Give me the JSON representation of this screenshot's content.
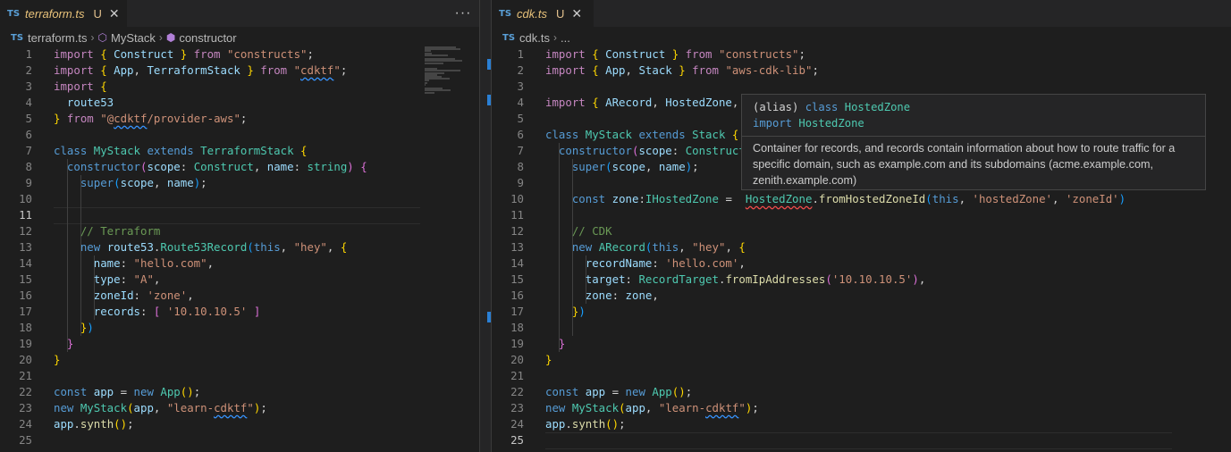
{
  "left": {
    "tab": {
      "label": "terraform.ts",
      "modified": "U",
      "icon": "TS"
    },
    "more_label": "···",
    "breadcrumb": [
      "terraform.ts",
      "MyStack",
      "constructor"
    ],
    "lines": [
      {
        "n": "1",
        "t": [
          [
            "kc",
            "import "
          ],
          [
            "b1",
            "{ "
          ],
          [
            "vr",
            "Construct"
          ],
          [
            "b1",
            " }"
          ],
          [
            "kc",
            " from "
          ],
          [
            "st",
            "\"constructs\""
          ],
          [
            "pl",
            ";"
          ]
        ]
      },
      {
        "n": "2",
        "t": [
          [
            "kc",
            "import "
          ],
          [
            "b1",
            "{ "
          ],
          [
            "vr",
            "App"
          ],
          [
            "pl",
            ", "
          ],
          [
            "vr",
            "TerraformStack"
          ],
          [
            "b1",
            " }"
          ],
          [
            "kc",
            " from "
          ],
          [
            "st",
            "\""
          ],
          [
            "st sq",
            "cdktf"
          ],
          [
            "st",
            "\""
          ],
          [
            "pl",
            ";"
          ]
        ]
      },
      {
        "n": "3",
        "t": [
          [
            "kc",
            "import "
          ],
          [
            "b1",
            "{"
          ]
        ]
      },
      {
        "n": "4",
        "t": [
          [
            "pl",
            "  "
          ],
          [
            "vr",
            "route53"
          ]
        ]
      },
      {
        "n": "5",
        "t": [
          [
            "b1",
            "}"
          ],
          [
            "kc",
            " from "
          ],
          [
            "st",
            "\"@"
          ],
          [
            "st sq",
            "cdktf"
          ],
          [
            "st",
            "/provider-aws\""
          ],
          [
            "pl",
            ";"
          ]
        ]
      },
      {
        "n": "6",
        "t": []
      },
      {
        "n": "7",
        "t": [
          [
            "kw",
            "class "
          ],
          [
            "ty",
            "MyStack"
          ],
          [
            "kw",
            " extends "
          ],
          [
            "ty",
            "TerraformStack"
          ],
          [
            "b1",
            " {"
          ]
        ]
      },
      {
        "n": "8",
        "t": [
          [
            "pl",
            "  "
          ],
          [
            "kw",
            "constructor"
          ],
          [
            "b2",
            "("
          ],
          [
            "vr",
            "scope"
          ],
          [
            "pl",
            ": "
          ],
          [
            "ty",
            "Construct"
          ],
          [
            "pl",
            ", "
          ],
          [
            "vr",
            "name"
          ],
          [
            "pl",
            ": "
          ],
          [
            "ty",
            "string"
          ],
          [
            "b2",
            ")"
          ],
          [
            "b2",
            " {"
          ]
        ]
      },
      {
        "n": "9",
        "t": [
          [
            "pl",
            "    "
          ],
          [
            "kw",
            "super"
          ],
          [
            "b3",
            "("
          ],
          [
            "vr",
            "scope"
          ],
          [
            "pl",
            ", "
          ],
          [
            "vr",
            "name"
          ],
          [
            "b3",
            ")"
          ],
          [
            "pl",
            ";"
          ]
        ]
      },
      {
        "n": "10",
        "t": []
      },
      {
        "n": "11",
        "t": []
      },
      {
        "n": "12",
        "t": [
          [
            "pl",
            "    "
          ],
          [
            "cm",
            "// Terraform"
          ]
        ]
      },
      {
        "n": "13",
        "t": [
          [
            "pl",
            "    "
          ],
          [
            "kw",
            "new "
          ],
          [
            "vr",
            "route53"
          ],
          [
            "pl",
            "."
          ],
          [
            "ty",
            "Route53Record"
          ],
          [
            "b3",
            "("
          ],
          [
            "kw",
            "this"
          ],
          [
            "pl",
            ", "
          ],
          [
            "st",
            "\"hey\""
          ],
          [
            "pl",
            ", "
          ],
          [
            "b1",
            "{"
          ]
        ]
      },
      {
        "n": "14",
        "t": [
          [
            "pl",
            "      "
          ],
          [
            "vr",
            "name"
          ],
          [
            "pl",
            ": "
          ],
          [
            "st",
            "\"hello.com\""
          ],
          [
            "pl",
            ","
          ]
        ]
      },
      {
        "n": "15",
        "t": [
          [
            "pl",
            "      "
          ],
          [
            "vr",
            "type"
          ],
          [
            "pl",
            ": "
          ],
          [
            "st",
            "\"A\""
          ],
          [
            "pl",
            ","
          ]
        ]
      },
      {
        "n": "16",
        "t": [
          [
            "pl",
            "      "
          ],
          [
            "vr",
            "zoneId"
          ],
          [
            "pl",
            ": "
          ],
          [
            "st",
            "'zone'"
          ],
          [
            "pl",
            ","
          ]
        ]
      },
      {
        "n": "17",
        "t": [
          [
            "pl",
            "      "
          ],
          [
            "vr",
            "records"
          ],
          [
            "pl",
            ": "
          ],
          [
            "b2",
            "[ "
          ],
          [
            "st",
            "'10.10.10.5'"
          ],
          [
            "b2",
            " ]"
          ]
        ]
      },
      {
        "n": "18",
        "t": [
          [
            "pl",
            "    "
          ],
          [
            "b1",
            "}"
          ],
          [
            "b3",
            ")"
          ]
        ]
      },
      {
        "n": "19",
        "t": [
          [
            "pl",
            "  "
          ],
          [
            "b2",
            "}"
          ]
        ]
      },
      {
        "n": "20",
        "t": [
          [
            "b1",
            "}"
          ]
        ]
      },
      {
        "n": "21",
        "t": []
      },
      {
        "n": "22",
        "t": [
          [
            "kw",
            "const "
          ],
          [
            "vr",
            "app"
          ],
          [
            "pl",
            " = "
          ],
          [
            "kw",
            "new "
          ],
          [
            "ty",
            "App"
          ],
          [
            "b1",
            "()"
          ],
          [
            "pl",
            ";"
          ]
        ]
      },
      {
        "n": "23",
        "t": [
          [
            "kw",
            "new "
          ],
          [
            "ty",
            "MyStack"
          ],
          [
            "b1",
            "("
          ],
          [
            "vr",
            "app"
          ],
          [
            "pl",
            ", "
          ],
          [
            "st",
            "\"learn-"
          ],
          [
            "st sq",
            "cdktf"
          ],
          [
            "st",
            "\""
          ],
          [
            "b1",
            ")"
          ],
          [
            "pl",
            ";"
          ]
        ]
      },
      {
        "n": "24",
        "t": [
          [
            "vr",
            "app"
          ],
          [
            "pl",
            "."
          ],
          [
            "fn",
            "synth"
          ],
          [
            "b1",
            "()"
          ],
          [
            "pl",
            ";"
          ]
        ]
      },
      {
        "n": "25",
        "t": []
      }
    ]
  },
  "right": {
    "tab": {
      "label": "cdk.ts",
      "modified": "U",
      "icon": "TS"
    },
    "breadcrumb": [
      "cdk.ts",
      "..."
    ],
    "lines": [
      {
        "n": "1",
        "t": [
          [
            "kc",
            "import "
          ],
          [
            "b1",
            "{ "
          ],
          [
            "vr",
            "Construct"
          ],
          [
            "b1",
            " }"
          ],
          [
            "kc",
            " from "
          ],
          [
            "st",
            "\"constructs\""
          ],
          [
            "pl",
            ";"
          ]
        ]
      },
      {
        "n": "2",
        "t": [
          [
            "kc",
            "import "
          ],
          [
            "b1",
            "{ "
          ],
          [
            "vr",
            "App"
          ],
          [
            "pl",
            ", "
          ],
          [
            "vr",
            "Stack"
          ],
          [
            "b1",
            " }"
          ],
          [
            "kc",
            " from "
          ],
          [
            "st",
            "\"aws-cdk-lib\""
          ],
          [
            "pl",
            ";"
          ]
        ]
      },
      {
        "n": "3",
        "t": []
      },
      {
        "n": "4",
        "t": [
          [
            "kc",
            "import "
          ],
          [
            "b1",
            "{ "
          ],
          [
            "vr",
            "ARecord"
          ],
          [
            "pl",
            ", "
          ],
          [
            "vr",
            "HostedZone"
          ],
          [
            "pl",
            ","
          ]
        ]
      },
      {
        "n": "5",
        "t": []
      },
      {
        "n": "6",
        "t": [
          [
            "kw",
            "class "
          ],
          [
            "ty",
            "MyStack"
          ],
          [
            "kw",
            " extends "
          ],
          [
            "ty",
            "Stack"
          ],
          [
            "b1",
            " {"
          ]
        ]
      },
      {
        "n": "7",
        "t": [
          [
            "pl",
            "  "
          ],
          [
            "kw",
            "constructor"
          ],
          [
            "b2",
            "("
          ],
          [
            "vr",
            "scope"
          ],
          [
            "pl",
            ": "
          ],
          [
            "ty",
            "Construct"
          ]
        ]
      },
      {
        "n": "8",
        "t": [
          [
            "pl",
            "    "
          ],
          [
            "kw",
            "super"
          ],
          [
            "b3",
            "("
          ],
          [
            "vr",
            "scope"
          ],
          [
            "pl",
            ", "
          ],
          [
            "vr",
            "name"
          ],
          [
            "b3",
            ")"
          ],
          [
            "pl",
            ";"
          ]
        ]
      },
      {
        "n": "9",
        "t": []
      },
      {
        "n": "10",
        "t": [
          [
            "pl",
            "    "
          ],
          [
            "kw",
            "const "
          ],
          [
            "vr",
            "zone"
          ],
          [
            "pl",
            ":"
          ],
          [
            "ty",
            "IHostedZone"
          ],
          [
            "pl",
            " =  "
          ],
          [
            "ty err",
            "HostedZone"
          ],
          [
            "pl",
            "."
          ],
          [
            "fn",
            "fromHostedZoneId"
          ],
          [
            "b3",
            "("
          ],
          [
            "kw",
            "this"
          ],
          [
            "pl",
            ", "
          ],
          [
            "st",
            "'hostedZone'"
          ],
          [
            "pl",
            ", "
          ],
          [
            "st",
            "'zoneId'"
          ],
          [
            "b3",
            ")"
          ]
        ]
      },
      {
        "n": "11",
        "t": []
      },
      {
        "n": "12",
        "t": [
          [
            "pl",
            "    "
          ],
          [
            "cm",
            "// CDK"
          ]
        ]
      },
      {
        "n": "13",
        "t": [
          [
            "pl",
            "    "
          ],
          [
            "kw",
            "new "
          ],
          [
            "ty",
            "ARecord"
          ],
          [
            "b3",
            "("
          ],
          [
            "kw",
            "this"
          ],
          [
            "pl",
            ", "
          ],
          [
            "st",
            "\"hey\""
          ],
          [
            "pl",
            ", "
          ],
          [
            "b1",
            "{"
          ]
        ]
      },
      {
        "n": "14",
        "t": [
          [
            "pl",
            "      "
          ],
          [
            "vr",
            "recordName"
          ],
          [
            "pl",
            ": "
          ],
          [
            "st",
            "'hello.com'"
          ],
          [
            "pl",
            ","
          ]
        ]
      },
      {
        "n": "15",
        "t": [
          [
            "pl",
            "      "
          ],
          [
            "vr",
            "target"
          ],
          [
            "pl",
            ": "
          ],
          [
            "ty",
            "RecordTarget"
          ],
          [
            "pl",
            "."
          ],
          [
            "fn",
            "fromIpAddresses"
          ],
          [
            "b2",
            "("
          ],
          [
            "st",
            "'10.10.10.5'"
          ],
          [
            "b2",
            ")"
          ],
          [
            "pl",
            ","
          ]
        ]
      },
      {
        "n": "16",
        "t": [
          [
            "pl",
            "      "
          ],
          [
            "vr",
            "zone"
          ],
          [
            "pl",
            ": "
          ],
          [
            "vr",
            "zone"
          ],
          [
            "pl",
            ","
          ]
        ]
      },
      {
        "n": "17",
        "t": [
          [
            "pl",
            "    "
          ],
          [
            "b1",
            "}"
          ],
          [
            "b3",
            ")"
          ]
        ]
      },
      {
        "n": "18",
        "t": []
      },
      {
        "n": "19",
        "t": [
          [
            "pl",
            "  "
          ],
          [
            "b2",
            "}"
          ]
        ]
      },
      {
        "n": "20",
        "t": [
          [
            "b1",
            "}"
          ]
        ]
      },
      {
        "n": "21",
        "t": []
      },
      {
        "n": "22",
        "t": [
          [
            "kw",
            "const "
          ],
          [
            "vr",
            "app"
          ],
          [
            "pl",
            " = "
          ],
          [
            "kw",
            "new "
          ],
          [
            "ty",
            "App"
          ],
          [
            "b1",
            "()"
          ],
          [
            "pl",
            ";"
          ]
        ]
      },
      {
        "n": "23",
        "t": [
          [
            "kw",
            "new "
          ],
          [
            "ty",
            "MyStack"
          ],
          [
            "b1",
            "("
          ],
          [
            "vr",
            "app"
          ],
          [
            "pl",
            ", "
          ],
          [
            "st",
            "\"learn-"
          ],
          [
            "st sq",
            "cdktf"
          ],
          [
            "st",
            "\""
          ],
          [
            "b1",
            ")"
          ],
          [
            "pl",
            ";"
          ]
        ]
      },
      {
        "n": "24",
        "t": [
          [
            "vr",
            "app"
          ],
          [
            "pl",
            "."
          ],
          [
            "fn",
            "synth"
          ],
          [
            "b1",
            "()"
          ],
          [
            "pl",
            ";"
          ]
        ]
      },
      {
        "n": "25",
        "t": []
      }
    ]
  },
  "hover": {
    "sig_line1": [
      [
        "pl",
        "(alias) "
      ],
      [
        "kw",
        "class "
      ],
      [
        "ty",
        "HostedZone"
      ]
    ],
    "sig_line2": [
      [
        "kw",
        "import "
      ],
      [
        "ty",
        "HostedZone"
      ]
    ],
    "doc": "Container for records, and records contain information about how to route traffic for a specific domain, such as example.com and its subdomains (acme.example.com, zenith.example.com)"
  },
  "colors": {
    "editor_bg": "#1e1e1e",
    "accent": "#2a7fd4"
  }
}
